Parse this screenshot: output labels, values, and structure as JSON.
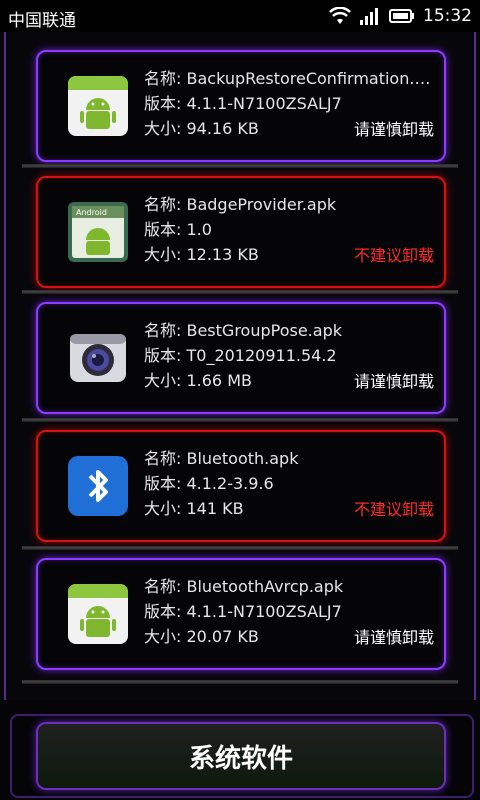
{
  "status_bar": {
    "carrier": "中国联通",
    "time": "15:32",
    "icons": [
      "wifi-icon",
      "signal-icon",
      "battery-icon"
    ]
  },
  "labels": {
    "name_prefix": "名称: ",
    "version_prefix": "版本: ",
    "size_prefix": "大小: "
  },
  "apps": [
    {
      "name": "BackupRestoreConfirmation.apk",
      "version": "4.1.1-N7100ZSALJ7",
      "size": "94.16 KB",
      "recommendation": "请谨慎卸载",
      "level": "caution",
      "icon": "android-icon"
    },
    {
      "name": "BadgeProvider.apk",
      "version": "1.0",
      "size": "12.13 KB",
      "recommendation": "不建议卸载",
      "level": "not-recommended",
      "icon": "android-badge-icon"
    },
    {
      "name": "BestGroupPose.apk",
      "version": "T0_20120911.54.2",
      "size": "1.66 MB",
      "recommendation": "请谨慎卸载",
      "level": "caution",
      "icon": "camera-icon"
    },
    {
      "name": "Bluetooth.apk",
      "version": "4.1.2-3.9.6",
      "size": "141 KB",
      "recommendation": "不建议卸载",
      "level": "not-recommended",
      "icon": "bluetooth-icon"
    },
    {
      "name": "BluetoothAvrcp.apk",
      "version": "4.1.1-N7100ZSALJ7",
      "size": "20.07 KB",
      "recommendation": "请谨慎卸载",
      "level": "caution",
      "icon": "android-icon"
    }
  ],
  "bottom_button": "系统软件",
  "colors": {
    "caution_border": "#8a3cff",
    "danger_border": "#d11414",
    "danger_text": "#ff2a2a"
  }
}
